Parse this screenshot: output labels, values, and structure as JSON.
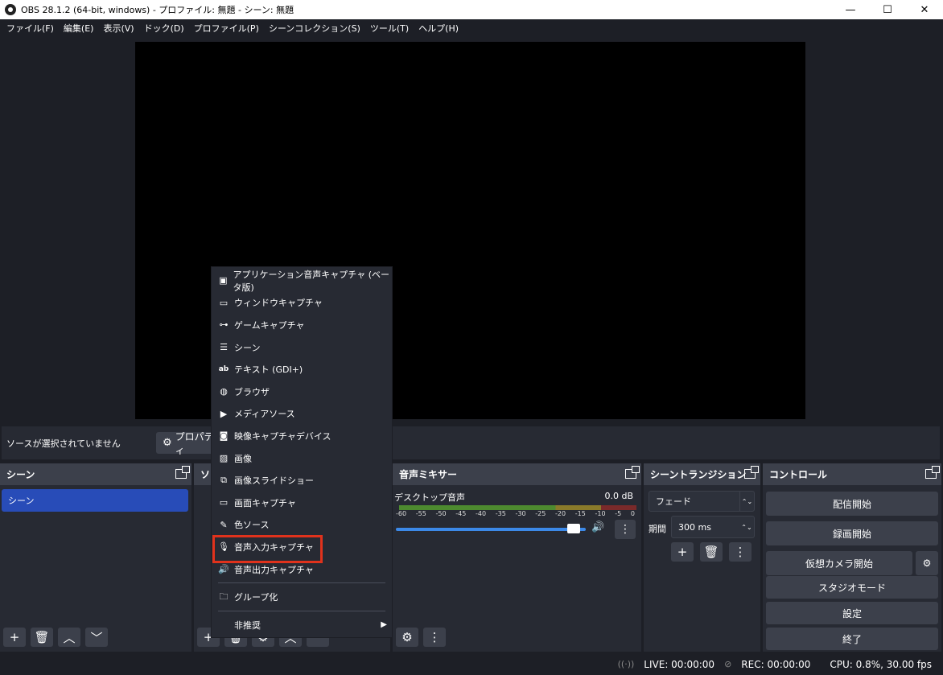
{
  "window": {
    "title": "OBS 28.1.2 (64-bit, windows) - プロファイル: 無題 - シーン: 無題",
    "minimize": "—",
    "maximize": "☐",
    "close": "✕"
  },
  "menubar": {
    "items": [
      "ファイル(F)",
      "編集(E)",
      "表示(V)",
      "ドック(D)",
      "プロファイル(P)",
      "シーンコレクション(S)",
      "ツール(T)",
      "ヘルプ(H)"
    ]
  },
  "context_bar": {
    "no_source": "ソースが選択されていません",
    "properties": "プロパティ"
  },
  "scenes": {
    "title": "シーン",
    "items": [
      "シーン"
    ]
  },
  "sources": {
    "title": "ソ"
  },
  "mixer": {
    "title": "音声ミキサー",
    "channel_name": "デスクトップ音声",
    "channel_db": "0.0 dB",
    "ticks": [
      "-60",
      "-55",
      "-50",
      "-45",
      "-40",
      "-35",
      "-30",
      "-25",
      "-20",
      "-15",
      "-10",
      "-5",
      "0"
    ],
    "volume": 0.96
  },
  "transitions": {
    "title": "シーントランジション",
    "selected": "フェード",
    "duration_label": "期間",
    "duration_value": "300 ms"
  },
  "controls": {
    "title": "コントロール",
    "start_streaming": "配信開始",
    "start_recording": "録画開始",
    "start_virtual_cam": "仮想カメラ開始",
    "studio_mode": "スタジオモード",
    "settings": "設定",
    "exit": "終了"
  },
  "statusbar": {
    "live": "LIVE: 00:00:00",
    "rec": "REC: 00:00:00",
    "cpu": "CPU: 0.8%, 30.00 fps"
  },
  "context_menu": {
    "items": [
      {
        "label": "アプリケーション音声キャプチャ (ベータ版)",
        "icon": "app-audio-icon"
      },
      {
        "label": "ウィンドウキャプチャ",
        "icon": "window-icon"
      },
      {
        "label": "ゲームキャプチャ",
        "icon": "gamepad-icon"
      },
      {
        "label": "シーン",
        "icon": "list-icon"
      },
      {
        "label": "テキスト (GDI+)",
        "icon": "text-icon"
      },
      {
        "label": "ブラウザ",
        "icon": "globe-icon"
      },
      {
        "label": "メディアソース",
        "icon": "play-icon"
      },
      {
        "label": "映像キャプチャデバイス",
        "icon": "camera-icon"
      },
      {
        "label": "画像",
        "icon": "image-icon"
      },
      {
        "label": "画像スライドショー",
        "icon": "slideshow-icon"
      },
      {
        "label": "画面キャプチャ",
        "icon": "monitor-icon"
      },
      {
        "label": "色ソース",
        "icon": "brush-icon"
      },
      {
        "label": "音声入力キャプチャ",
        "icon": "microphone-icon"
      },
      {
        "label": "音声出力キャプチャ",
        "icon": "speaker-icon"
      }
    ],
    "group": "グループ化",
    "deprecated": "非推奨"
  }
}
